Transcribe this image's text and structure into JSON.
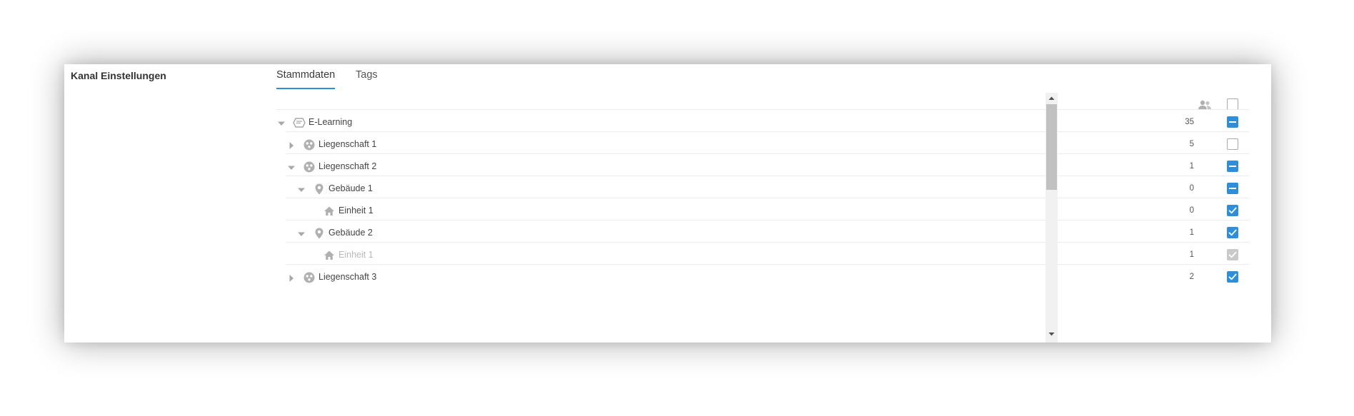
{
  "page": {
    "title": "Kanal Einstellungen"
  },
  "tabs": [
    {
      "label": "Stammdaten",
      "active": true
    },
    {
      "label": "Tags",
      "active": false
    }
  ],
  "tree": {
    "header": {
      "users_icon": "people-icon",
      "select_all": "empty"
    },
    "rows": [
      {
        "label": "E-Learning",
        "icon": "channel-icon",
        "level": 0,
        "toggle": "expanded",
        "count": "35",
        "check": "partial"
      },
      {
        "label": "Liegenschaft 1",
        "icon": "property-icon",
        "level": 1,
        "toggle": "collapsed",
        "count": "5",
        "check": "empty"
      },
      {
        "label": "Liegenschaft 2",
        "icon": "property-icon",
        "level": 1,
        "toggle": "expanded",
        "count": "1",
        "check": "partial"
      },
      {
        "label": "Gebäude 1",
        "icon": "location-icon",
        "level": 2,
        "toggle": "expanded",
        "count": "0",
        "check": "partial"
      },
      {
        "label": "Einheit 1",
        "icon": "home-icon",
        "level": 3,
        "toggle": "none",
        "count": "0",
        "check": "checked"
      },
      {
        "label": "Gebäude 2",
        "icon": "location-icon",
        "level": 2,
        "toggle": "expanded",
        "count": "1",
        "check": "checked"
      },
      {
        "label": "Einheit 1",
        "icon": "home-icon",
        "level": 3,
        "toggle": "none",
        "count": "1",
        "check": "disabled",
        "muted": true
      },
      {
        "label": "Liegenschaft 3",
        "icon": "property-icon",
        "level": 1,
        "toggle": "collapsed",
        "count": "2",
        "check": "checked"
      }
    ]
  },
  "colors": {
    "accent": "#2d8fdb",
    "icon_gray": "#b0b0b0",
    "disabled": "#c9c9c9"
  }
}
